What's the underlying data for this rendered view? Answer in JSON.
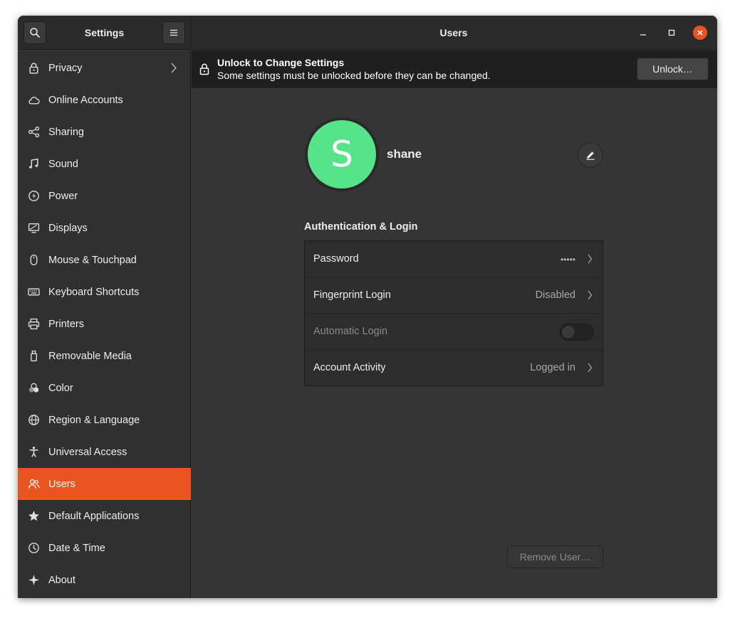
{
  "header": {
    "left_title": "Settings",
    "main_title": "Users"
  },
  "sidebar": {
    "items": [
      {
        "label": "Privacy",
        "icon": "lock-icon",
        "has_chevron": true
      },
      {
        "label": "Online Accounts",
        "icon": "cloud-icon"
      },
      {
        "label": "Sharing",
        "icon": "share-icon"
      },
      {
        "label": "Sound",
        "icon": "music-note-icon"
      },
      {
        "label": "Power",
        "icon": "power-icon"
      },
      {
        "label": "Displays",
        "icon": "display-icon"
      },
      {
        "label": "Mouse & Touchpad",
        "icon": "mouse-icon"
      },
      {
        "label": "Keyboard Shortcuts",
        "icon": "keyboard-icon"
      },
      {
        "label": "Printers",
        "icon": "printer-icon"
      },
      {
        "label": "Removable Media",
        "icon": "removable-media-icon"
      },
      {
        "label": "Color",
        "icon": "color-icon"
      },
      {
        "label": "Region & Language",
        "icon": "globe-icon"
      },
      {
        "label": "Universal Access",
        "icon": "accessibility-icon"
      },
      {
        "label": "Users",
        "icon": "users-icon",
        "active": true
      },
      {
        "label": "Default Applications",
        "icon": "star-icon"
      },
      {
        "label": "Date & Time",
        "icon": "clock-icon"
      },
      {
        "label": "About",
        "icon": "sparkle-icon"
      }
    ]
  },
  "infobar": {
    "title": "Unlock to Change Settings",
    "subtitle": "Some settings must be unlocked before they can be changed.",
    "unlock_label": "Unlock…"
  },
  "user": {
    "avatar_initial": "S",
    "name": "shane",
    "avatar_color": "#57e389"
  },
  "auth": {
    "section_title": "Authentication & Login",
    "rows": [
      {
        "label": "Password",
        "value": "•••••"
      },
      {
        "label": "Fingerprint Login",
        "value": "Disabled"
      },
      {
        "label": "Automatic Login",
        "toggle": false
      },
      {
        "label": "Account Activity",
        "value": "Logged in"
      }
    ]
  },
  "actions": {
    "remove_user_label": "Remove User…"
  },
  "colors": {
    "accent": "#e95420",
    "background": "#353535",
    "sidebar": "#303030"
  }
}
